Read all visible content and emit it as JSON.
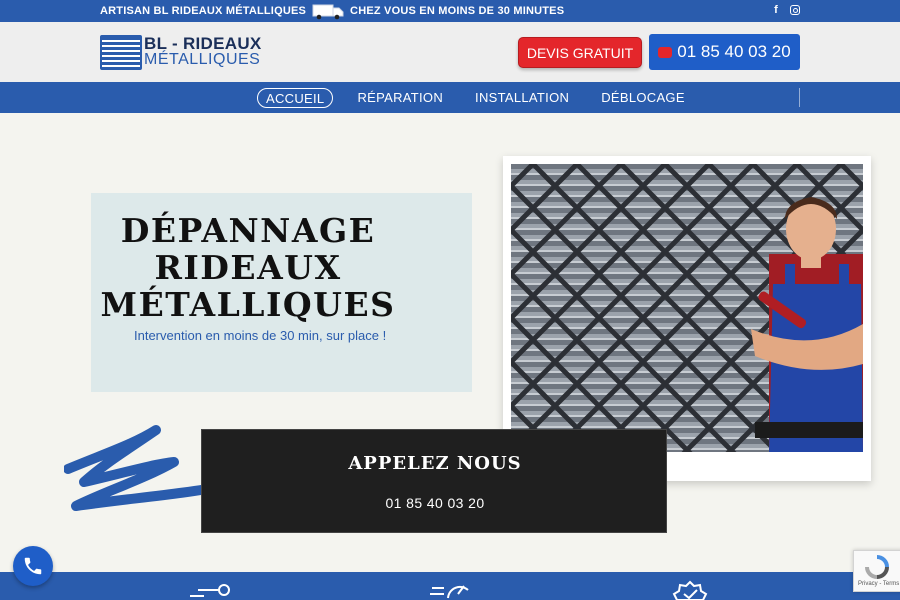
{
  "topbar": {
    "artisan_text": "ARTISAN BL RIDEAUX MÉTALLIQUES",
    "promise_text": "CHEZ VOUS EN MOINS DE 30 MINUTES",
    "facebook_glyph": "f",
    "icons": [
      "van-icon",
      "facebook-icon",
      "instagram-icon"
    ]
  },
  "header": {
    "logo_line1": "BL - RIDEAUX",
    "logo_line2": "MÉTALLIQUES",
    "devis_label": "DEVIS GRATUIT",
    "phone_label": "01 85 40 03 20"
  },
  "nav": {
    "items": [
      {
        "label": "ACCUEIL",
        "active": true
      },
      {
        "label": "RÉPARATION",
        "active": false
      },
      {
        "label": "INSTALLATION",
        "active": false
      },
      {
        "label": "DÉBLOCAGE",
        "active": false
      }
    ]
  },
  "hero": {
    "title_lines": [
      "DÉPANNAGE",
      "RIDEAUX",
      "MÉTALLIQUES"
    ],
    "subtitle": "Intervention en moins de 30 min, sur place !"
  },
  "cta": {
    "title": "APPELEZ NOUS",
    "phone": "01 85 40 03 20"
  },
  "recaptcha": {
    "text": "Privacy - Terms"
  },
  "colors": {
    "brand_blue": "#2a5cad",
    "button_red": "#e4262b",
    "phone_blue": "#1f5ec8",
    "hero_box": "#dde9ea",
    "cta_bg": "#1f1f1f"
  }
}
